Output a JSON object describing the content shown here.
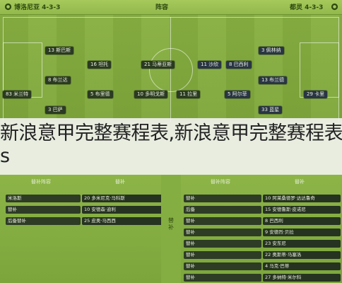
{
  "header": {
    "left_team": "博洛尼亚 4-3-3",
    "center_title": "阵容",
    "right_team": "都灵 4-3-3"
  },
  "left_players": [
    {
      "label": "13 斯巴斯"
    },
    {
      "label": "16 坦托"
    },
    {
      "label": "8 布兰达"
    },
    {
      "label": "21 马蒂亚斯"
    },
    {
      "label": "83 米兰特"
    },
    {
      "label": "5 布里德"
    },
    {
      "label": "10 多明戈斯"
    },
    {
      "label": "11 拉里"
    },
    {
      "label": "3 巴萨"
    }
  ],
  "right_players": [
    {
      "label": "3 佩林纳"
    },
    {
      "label": "8 巴西利"
    },
    {
      "label": "13 布兰德"
    },
    {
      "label": "5 阿尔菲"
    },
    {
      "label": "29 卡里"
    },
    {
      "label": "11 沙欣"
    },
    {
      "label": "33 蓝星"
    }
  ],
  "overlay": {
    "line1": "新浪意甲完整赛程表,新浪意甲完整赛程表d",
    "line2": "s"
  },
  "bench": {
    "left_col1_head": "替补阵容",
    "left_col2_head": "替补",
    "right_col1_head": "替补阵容",
    "right_col2_head": "替补",
    "mid_label": "替补",
    "left_col1": [
      "米洛斯",
      "替补",
      "后备替补"
    ],
    "left_col2": [
      "20 多米尼克·马科斯",
      "10 安德森·迪利",
      "25 皮奥·马西西"
    ],
    "right_col1": [
      "替补",
      "后备",
      "替补",
      "替补",
      "替补",
      "替补",
      "替补",
      "替补"
    ],
    "right_col2": [
      "10 阿莱桑德罗·达达鲁奇",
      "15 安德鲁斯·皮诺尼",
      "8 巴西利",
      "9 安德烈·贝拉",
      "23 安东尼",
      "22 奥斯蒂·马塞洛",
      "4 马克·巴蒂",
      "27 多纳特·米尔科"
    ]
  }
}
